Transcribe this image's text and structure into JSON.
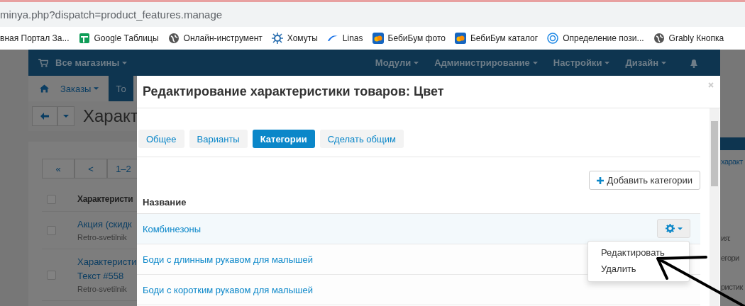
{
  "browser": {
    "url": "minya.php?dispatch=product_features.manage",
    "bookmarks": [
      {
        "label": "вная Портал За...",
        "kind": "none"
      },
      {
        "label": "Google Таблицы",
        "kind": "sheet"
      },
      {
        "label": "Онлайн-инструмент",
        "kind": "globe"
      },
      {
        "label": "Хомуты",
        "kind": "cog"
      },
      {
        "label": "Linas",
        "kind": "wave"
      },
      {
        "label": "БебиБум фото",
        "kind": "cloud"
      },
      {
        "label": "БебиБум каталог",
        "kind": "cloud"
      },
      {
        "label": "Определение пози...",
        "kind": "target"
      },
      {
        "label": "Grably Кнопка",
        "kind": "globe"
      }
    ]
  },
  "admin": {
    "store_menu": "Все магазины",
    "menu": [
      "Модули",
      "Администрирование",
      "Настройки",
      "Дизайн"
    ],
    "nav": [
      "Заказы",
      "То"
    ],
    "page_title": "Характ",
    "pagination": [
      "«",
      "<",
      "1–2"
    ],
    "table_header": "Характеристи",
    "header_checked": false,
    "rows": [
      {
        "title": "Акция (скидк",
        "store": "Retro-svetilnik",
        "checked": false
      },
      {
        "title": "Характеристи",
        "sub": "Текст #558",
        "store": "Retro-svetilnik",
        "checked": false
      }
    ],
    "side_link": "характ",
    "side_texts": [
      "ия:",
      "егори",
      "ристик"
    ]
  },
  "dialog": {
    "title": "Редактирование характеристики товаров: Цвет",
    "tabs": [
      {
        "label": "Общее",
        "selected": false
      },
      {
        "label": "Варианты",
        "selected": false
      },
      {
        "label": "Категории",
        "selected": true
      },
      {
        "label": "Сделать общим",
        "selected": false
      }
    ],
    "add_button": "Добавить категории",
    "column": "Название",
    "rows": [
      {
        "name": "Комбинезоны",
        "highlighted": true
      },
      {
        "name": "Боди с длинным рукавом для малышей",
        "highlighted": false
      },
      {
        "name": "Боди с коротким рукавом для малышей",
        "highlighted": false
      }
    ],
    "menu": [
      "Редактировать",
      "Удалить"
    ]
  }
}
